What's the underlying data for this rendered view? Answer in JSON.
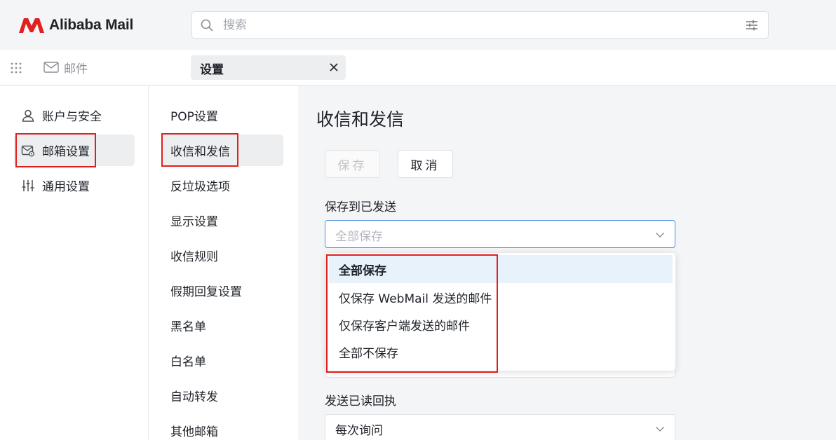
{
  "app": {
    "title": "Alibaba Mail"
  },
  "search": {
    "placeholder": "搜索"
  },
  "tabbar": {
    "mail_label": "邮件",
    "settings_label": "设置"
  },
  "leftnav": {
    "items": [
      {
        "label": "账户与安全",
        "icon": "user-icon"
      },
      {
        "label": "邮箱设置",
        "icon": "mailbox-settings-icon",
        "active": true
      },
      {
        "label": "通用设置",
        "icon": "sliders-icon"
      }
    ]
  },
  "subnav": {
    "items": [
      {
        "label": "POP设置"
      },
      {
        "label": "收信和发信",
        "active": true
      },
      {
        "label": "反垃圾选项"
      },
      {
        "label": "显示设置"
      },
      {
        "label": "收信规则"
      },
      {
        "label": "假期回复设置"
      },
      {
        "label": "黑名单"
      },
      {
        "label": "白名单"
      },
      {
        "label": "自动转发"
      },
      {
        "label": "其他邮箱"
      }
    ]
  },
  "main": {
    "title": "收信和发信",
    "save_label": "保存",
    "cancel_label": "取消",
    "save_to_sent": {
      "label": "保存到已发送",
      "value": "全部保存",
      "options": [
        "全部保存",
        "仅保存 WebMail 发送的邮件",
        "仅保存客户端发送的邮件",
        "全部不保存"
      ]
    },
    "read_receipt": {
      "label": "发送已读回执",
      "value": "每次询问"
    }
  },
  "colors": {
    "brand": "#e02020",
    "accent": "#4a90e2",
    "selected_bg": "#e8f2fb"
  }
}
